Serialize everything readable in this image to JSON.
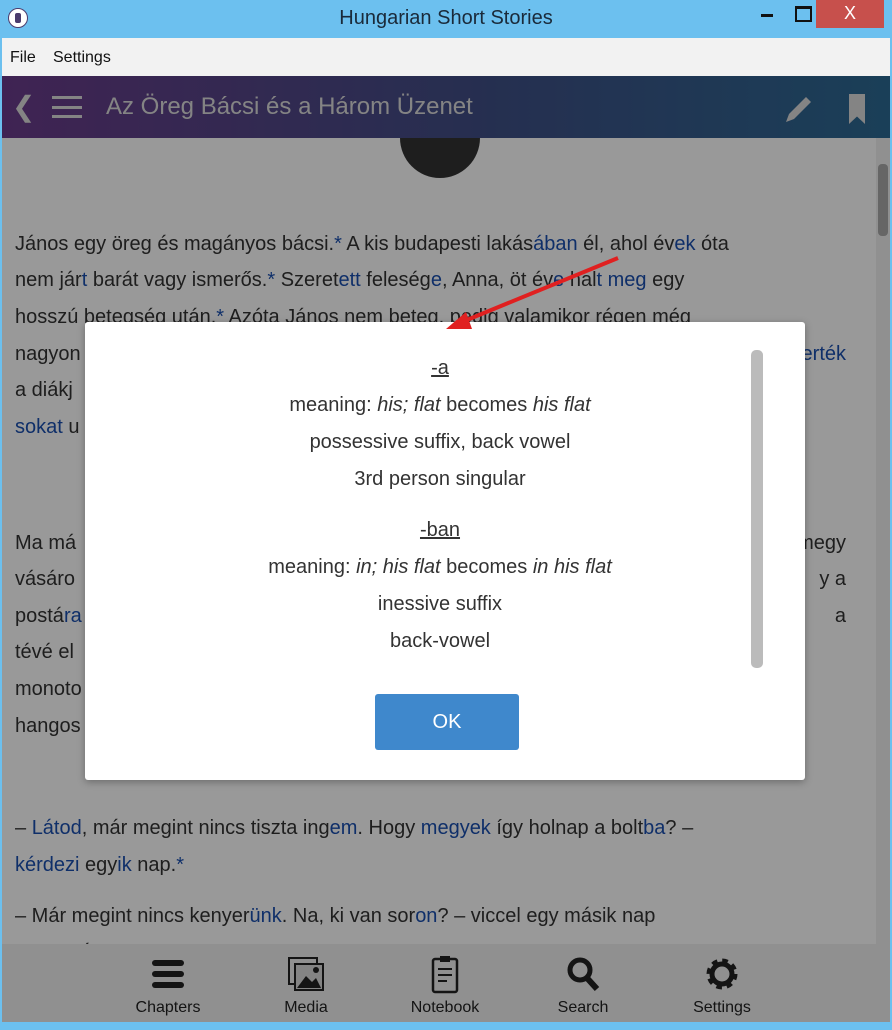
{
  "window": {
    "title": "Hungarian Short Stories",
    "close": "X"
  },
  "menu": {
    "file": "File",
    "settings": "Settings"
  },
  "header": {
    "title": "Az Öreg Bácsi és a Három Üzenet"
  },
  "story": {
    "lines": [
      [
        {
          "t": "János egy öreg és magányos bácsi.",
          "l": false
        },
        {
          "t": "*",
          "l": true
        },
        {
          "t": " A kis budapesti lakás",
          "l": false
        },
        {
          "t": "ában",
          "l": true
        },
        {
          "t": " él, ahol év",
          "l": false
        },
        {
          "t": "ek",
          "l": true
        },
        {
          "t": " óta",
          "l": false
        }
      ],
      [
        {
          "t": "nem jár",
          "l": false
        },
        {
          "t": "t",
          "l": true
        },
        {
          "t": " barát vagy ismerős.",
          "l": false
        },
        {
          "t": "*",
          "l": true
        },
        {
          "t": " Szeret",
          "l": false
        },
        {
          "t": "ett",
          "l": true
        },
        {
          "t": " feleség",
          "l": false
        },
        {
          "t": "e",
          "l": true
        },
        {
          "t": ", Anna, öt év",
          "l": false
        },
        {
          "t": "e",
          "l": true
        },
        {
          "t": " hal",
          "l": false
        },
        {
          "t": "t",
          "l": true
        },
        {
          "t": " ",
          "l": false
        },
        {
          "t": "meg",
          "l": true
        },
        {
          "t": " egy",
          "l": false
        }
      ],
      [
        {
          "t": "hosszú betegség után.",
          "l": false
        },
        {
          "t": "*",
          "l": true
        },
        {
          "t": " Azóta János nem beteg, pedig valamikor régen még",
          "l": false
        }
      ],
      [
        {
          "t": "nagyon",
          "l": false
        }
      ],
      [
        {
          "t": "a diákj",
          "l": false
        }
      ],
      [
        {
          "t": "sokat",
          "l": true
        },
        {
          "t": " u",
          "l": false
        }
      ],
      [
        {
          "t": "Ma má",
          "l": false
        }
      ],
      [
        {
          "t": "vásáro",
          "l": false
        }
      ],
      [
        {
          "t": "postá",
          "l": false
        },
        {
          "t": "ra",
          "l": true
        }
      ],
      [
        {
          "t": "tévé el",
          "l": false
        }
      ],
      [
        {
          "t": "monoto",
          "l": false
        }
      ],
      [
        {
          "t": "hangos",
          "l": false
        }
      ],
      [
        {
          "t": "– ",
          "l": false
        },
        {
          "t": "Látod",
          "l": true
        },
        {
          "t": ", már megint nincs tiszta ing",
          "l": false
        },
        {
          "t": "em",
          "l": true
        },
        {
          "t": ". Hogy ",
          "l": false
        },
        {
          "t": "megyek",
          "l": true
        },
        {
          "t": " így holnap a bolt",
          "l": false
        },
        {
          "t": "ba",
          "l": true
        },
        {
          "t": "? –",
          "l": false
        }
      ],
      [
        {
          "t": "kérdezi",
          "l": true
        },
        {
          "t": " egy",
          "l": false
        },
        {
          "t": "ik",
          "l": true
        },
        {
          "t": " nap.",
          "l": false
        },
        {
          "t": "*",
          "l": true
        }
      ],
      [
        {
          "t": "– Már megint nincs kenyer",
          "l": false
        },
        {
          "t": "ünk",
          "l": true
        },
        {
          "t": ". Na, ki van sor",
          "l": false
        },
        {
          "t": "on",
          "l": true
        },
        {
          "t": "? – viccel egy másik nap",
          "l": false
        }
      ],
      [
        {
          "t": "szomorú",
          "l": false
        },
        {
          "t": "an",
          "l": true
        },
        {
          "t": ".",
          "l": false
        },
        {
          "t": "*",
          "l": true
        }
      ]
    ],
    "right_fragments": [
      [
        {
          "t": "erték",
          "l": true
        }
      ],
      [
        {
          "t": "megy",
          "l": false
        }
      ],
      [
        {
          "t": "y a",
          "l": false
        }
      ],
      [
        {
          "t": "a",
          "l": false
        }
      ]
    ]
  },
  "dialog": {
    "entries": [
      {
        "head": "-a",
        "meaning_label": "meaning: ",
        "meaning_it1": "his; flat",
        "meaning_mid": " becomes ",
        "meaning_it2": "his flat",
        "line3": "possessive suffix, back vowel",
        "line4": "3rd person singular"
      },
      {
        "head": "-ban",
        "meaning_label": "meaning: ",
        "meaning_it1": "in; his flat",
        "meaning_mid": " becomes ",
        "meaning_it2": "in his flat",
        "line3": "inessive suffix",
        "line4": "back-vowel"
      }
    ],
    "ok": "OK"
  },
  "bottom_nav": [
    {
      "label": "Chapters",
      "icon": "bars-icon"
    },
    {
      "label": "Media",
      "icon": "images-icon"
    },
    {
      "label": "Notebook",
      "icon": "clipboard-icon"
    },
    {
      "label": "Search",
      "icon": "search-icon"
    },
    {
      "label": "Settings",
      "icon": "gear-icon"
    }
  ],
  "colors": {
    "accent": "#3f88cc",
    "link": "#1a4fb0",
    "annotation_arrow": "#e02020",
    "close": "#c7504c"
  }
}
